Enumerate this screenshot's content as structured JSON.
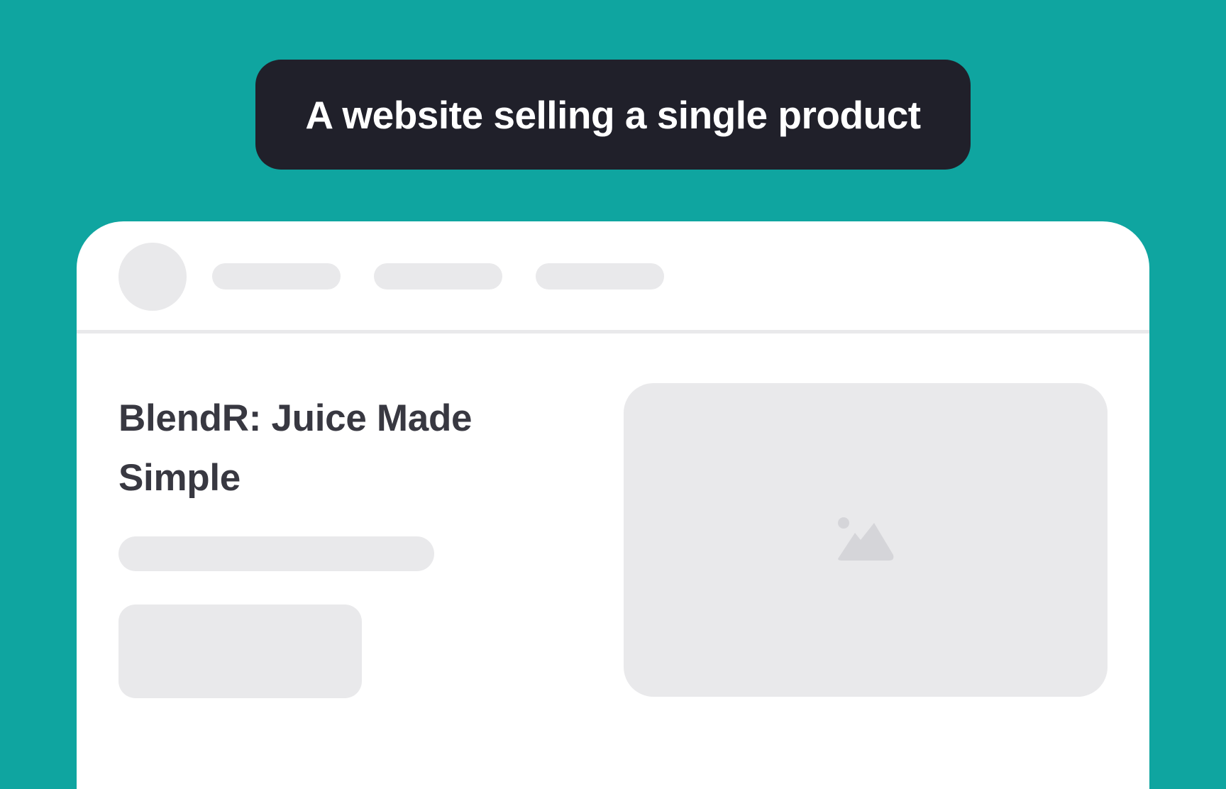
{
  "banner": {
    "title": "A website selling a single product"
  },
  "page": {
    "hero_title": "BlendR: Juice Made Simple"
  },
  "icons": {
    "product_image": "image-icon",
    "logo": "logo-placeholder"
  },
  "colors": {
    "background": "#0fa5a0",
    "banner": "#20202a",
    "placeholder": "#e9e9eb",
    "heading_text": "#383841",
    "icon": "#d5d5d9"
  }
}
